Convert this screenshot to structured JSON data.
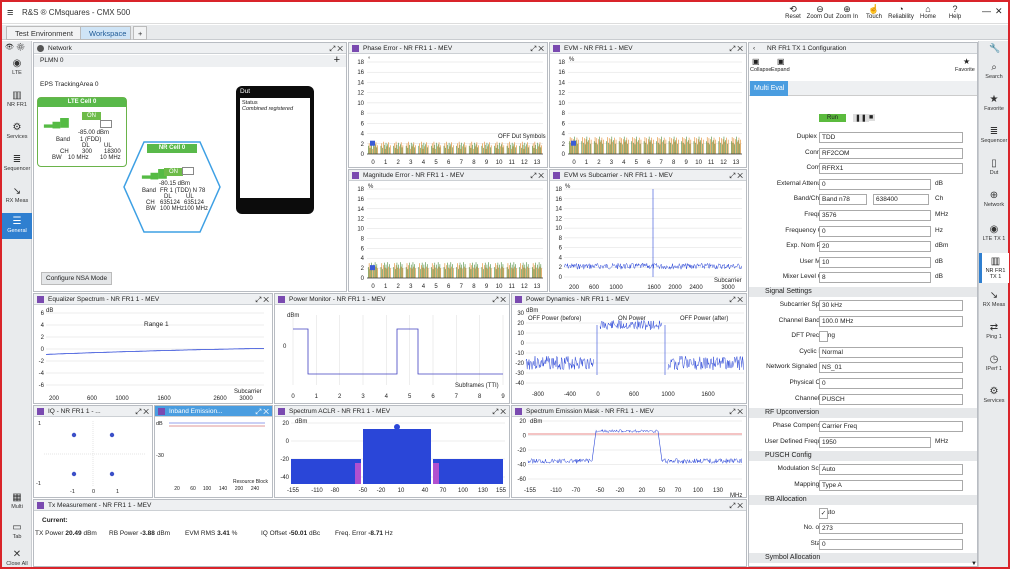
{
  "window": {
    "title": "R&S ® CMsquares - CMX 500"
  },
  "toolbar": {
    "items": [
      {
        "label": "Reset",
        "icon": "undo-icon",
        "glyph": "⟲"
      },
      {
        "label": "Zoom Out",
        "icon": "zoom-out-icon",
        "glyph": "⊖"
      },
      {
        "label": "Zoom In",
        "icon": "zoom-in-icon",
        "glyph": "⊕"
      },
      {
        "label": "Touch",
        "icon": "touch-icon",
        "glyph": "☝"
      },
      {
        "label": "Reliability",
        "icon": "reliability-icon",
        "glyph": "◔"
      },
      {
        "label": "Home",
        "icon": "home-icon",
        "glyph": "⌂"
      },
      {
        "label": "Help",
        "icon": "help-icon",
        "glyph": "?"
      }
    ]
  },
  "tabs": [
    {
      "label": "Test Environment"
    },
    {
      "label": "Workspace"
    },
    {
      "label": "+"
    }
  ],
  "left_sidebar": [
    {
      "label": "LTE",
      "glyph": "◉",
      "icon": "lte-icon"
    },
    {
      "label": "NR FR1",
      "glyph": "▥",
      "icon": "nr-icon"
    },
    {
      "label": "Services",
      "glyph": "⚙",
      "icon": "services-icon"
    },
    {
      "label": "Sequencer",
      "glyph": "≣",
      "icon": "sequencer-icon"
    },
    {
      "label": "RX Meas",
      "glyph": "↘",
      "icon": "rx-meas-icon"
    },
    {
      "label": "General",
      "glyph": "☰",
      "icon": "general-icon"
    },
    {
      "label": "Multi",
      "glyph": "▦",
      "icon": "multi-icon"
    },
    {
      "label": "Tab",
      "glyph": "▭",
      "icon": "tab-icon"
    },
    {
      "label": "Close All",
      "glyph": "✕",
      "icon": "close-all-icon"
    }
  ],
  "right_sidebar": [
    {
      "label": "Search",
      "glyph": "⌕",
      "icon": "search-icon"
    },
    {
      "label": "Favorite",
      "glyph": "★",
      "icon": "favorite-icon"
    },
    {
      "label": "Sequencer",
      "glyph": "≣",
      "icon": "sequencer-icon"
    },
    {
      "label": "Dut",
      "glyph": "▯",
      "icon": "dut-icon"
    },
    {
      "label": "Network",
      "glyph": "⊕",
      "icon": "network-icon"
    },
    {
      "label": "LTE TX 1",
      "glyph": "◉",
      "icon": "lte-tx-icon"
    },
    {
      "label": "NR FR1 TX 1",
      "glyph": "▥",
      "icon": "nr-tx-icon"
    },
    {
      "label": "RX Meas",
      "glyph": "↘",
      "icon": "rx-meas-icon"
    },
    {
      "label": "Ping 1",
      "glyph": "⇄",
      "icon": "ping-icon"
    },
    {
      "label": "IPerf 1",
      "glyph": "◷",
      "icon": "iperf-icon"
    },
    {
      "label": "Services",
      "glyph": "⚙",
      "icon": "services-icon"
    }
  ],
  "network": {
    "title": "Network",
    "plmn": "PLMN 0",
    "tracking": "EPS TrackingArea 0",
    "lte": {
      "head": "LTE Cell 0",
      "state": "ON",
      "power": "-85.00 dBm",
      "band": "Band",
      "band_val": "1 (FDD)",
      "dl": "DL",
      "ul": "UL",
      "ch": "CH",
      "ch_dl": "300",
      "ch_ul": "18300",
      "bw": "BW",
      "bw_dl": "10 MHz",
      "bw_ul": "10 MHz"
    },
    "nr": {
      "head": "NR Cell 0",
      "state": "ON",
      "power": "-80.15 dBm",
      "band": "Band",
      "band_val": "FR 1 (TDD) N 78",
      "dl": "DL",
      "ul": "UL",
      "ch": "CH",
      "ch_dl": "635124",
      "ch_ul": "635124",
      "bw": "BW",
      "bw_dl": "100 MHz",
      "bw_ul": "100 MHz"
    },
    "dut": {
      "title": "Dut",
      "status_label": "Status",
      "status": "Combined registered"
    },
    "nsa_button": "Configure NSA Mode"
  },
  "panels": {
    "phase": "Phase Error - NR FR1 1 - MEV",
    "evm": "EVM - NR FR1 1 - MEV",
    "mag": "Magnitude Error - NR FR1 1 - MEV",
    "evmsub": "EVM vs Subcarrier - NR FR1 1 - MEV",
    "eq": "Equalizer Spectrum - NR FR1 1 - MEV",
    "pmon": "Power Monitor - NR FR1 1 - MEV",
    "pdyn": "Power Dynamics - NR FR1 1 - MEV",
    "iq": "IQ - NR FR1 1 - ...",
    "inband": "Inband Emission...",
    "aclr": "Spectrum ACLR - NR FR1 1 - MEV",
    "sem": "Spectrum Emission Mask - NR FR1 1 - MEV"
  },
  "labels": {
    "deg": "°",
    "pct": "%",
    "db": "dB",
    "dbm": "dBm",
    "subcarrier": "Subcarrier",
    "subframes": "Subframes (TTI)",
    "mhz": "MHz",
    "range1": "Range 1",
    "resource_block": "Resource Block",
    "off_before": "OFF Power (before)",
    "on_power": "ON Power",
    "off_after": "OFF Power (after)",
    "off_dut": "OFF Dut Symbols"
  },
  "config": {
    "title": "NR FR1 TX 1 Configuration",
    "collapse": "Collapse",
    "expand": "Expand",
    "favorite": "Favorite",
    "tab": "Multi Eval",
    "run": "Run",
    "rows1": [
      {
        "label": "Duplex Mode",
        "value": "TDD"
      },
      {
        "label": "Connector",
        "value": "RF2COM"
      },
      {
        "label": "Converter",
        "value": "RFRX1"
      },
      {
        "label": "External Attenuation",
        "value": "0",
        "unit": "dB"
      },
      {
        "label": "Band/Channel",
        "value": "Band n78",
        "value2": "638400",
        "unit": "Ch"
      },
      {
        "label": "Frequency",
        "value": "3576",
        "unit": "MHz"
      },
      {
        "label": "Frequency Offset",
        "value": "0",
        "unit": "Hz"
      },
      {
        "label": "Exp. Nom Power",
        "value": "20",
        "unit": "dBm"
      },
      {
        "label": "User Margin",
        "value": "10",
        "unit": "dB"
      },
      {
        "label": "Mixer Level Offset",
        "value": "8",
        "unit": "dB"
      }
    ],
    "signal_settings": "Signal Settings",
    "rows2": [
      {
        "label": "Subcarrier Spacing",
        "value": "30 kHz"
      },
      {
        "label": "Channel Bandwidth",
        "value": "100.0 MHz"
      },
      {
        "label": "DFT Precoding",
        "value": ""
      },
      {
        "label": "Cyclic Prefix",
        "value": "Normal"
      },
      {
        "label": "Network Signaled Value",
        "value": "NS_01"
      },
      {
        "label": "Physical Cell ID",
        "value": "0"
      },
      {
        "label": "Channel Type",
        "value": "PUSCH"
      }
    ],
    "rf_up": "RF Upconversion",
    "rows3": [
      {
        "label": "Phase Compensation",
        "value": "Carrier Freq"
      },
      {
        "label": "User Defined Frequency",
        "value": "1950",
        "unit": "MHz"
      }
    ],
    "pusch": "PUSCH Config",
    "rows4": [
      {
        "label": "Modulation Scheme",
        "value": "Auto"
      },
      {
        "label": "Mapping Type",
        "value": "Type A"
      }
    ],
    "rb": "RB Allocation",
    "rows5": [
      {
        "label": "Auto",
        "value": "✓"
      },
      {
        "label": "No. of RBs",
        "value": "273"
      },
      {
        "label": "Start RB",
        "value": "0"
      }
    ],
    "symbol": "Symbol Allocation"
  },
  "txm": {
    "title": "Tx Measurement - NR FR1 1 - MEV",
    "current": "Current:",
    "items": [
      {
        "label": "TX Power",
        "value": "20.49",
        "unit": "dBm"
      },
      {
        "label": "RB Power",
        "value": "-3.88",
        "unit": "dBm"
      },
      {
        "label": "EVM RMS",
        "value": "3.41",
        "unit": "%"
      },
      {
        "label": "IQ Offset",
        "value": "-50.01",
        "unit": "dBc"
      },
      {
        "label": "Freq. Error",
        "value": "-8.71",
        "unit": "Hz"
      }
    ]
  }
}
